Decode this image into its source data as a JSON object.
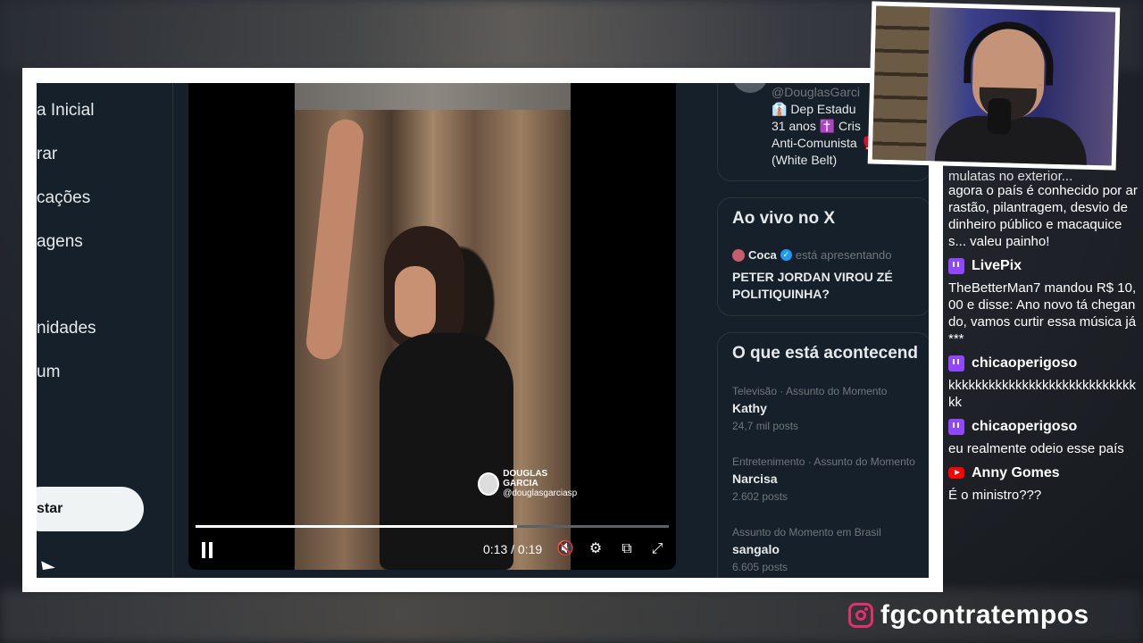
{
  "nav": {
    "items": [
      "a Inicial",
      "rar",
      "cações",
      "agens",
      "nidades",
      "um"
    ],
    "post_label": "star"
  },
  "video": {
    "watermark_name": "DOUGLAS GARCIA",
    "watermark_handle": "@douglasgarciasp",
    "time": "0:13 / 0:19",
    "progress": 0.68,
    "icons": [
      "pause-icon",
      "mute-icon",
      "settings-icon",
      "pip-icon",
      "fullscreen-icon"
    ]
  },
  "profile": {
    "handle": "@DouglasGarci",
    "bio_line1": "👔 Dep Estadu",
    "bio_line2": "31 anos ✝️ Cris",
    "bio_line3": "Anti-Comunista 🥊 Boxe",
    "bio_line4": "(White Belt)"
  },
  "live": {
    "title": "Ao vivo no X",
    "host": "Coca",
    "status": "está apresentando",
    "stream_title": "PETER JORDAN VIROU ZÉ POLITIQUINHA?"
  },
  "trends": {
    "title": "O que está acontecend",
    "items": [
      {
        "meta": "Televisão · Assunto do Momento",
        "name": "Kathy",
        "count": "24,7 mil posts"
      },
      {
        "meta": "Entretenimento · Assunto do Momento",
        "name": "Narcisa",
        "count": "2.602 posts"
      },
      {
        "meta": "Assunto do Momento em Brasil",
        "name": "sangalo",
        "count": "6.605 posts"
      }
    ]
  },
  "chat": {
    "fade_text": "mulatas no exterior...",
    "first_text": "agora o país é conhecido por arrastão, pilantragem, desvio de dinheiro público e macaquices... valeu painho!",
    "messages": [
      {
        "platform": "twitch",
        "user": "LivePix",
        "text": "TheBetterMan7 mandou R$ 10,00 e disse: Ano novo tá chegando, vamos curtir essa música já ***"
      },
      {
        "platform": "twitch",
        "user": "chicaoperigoso",
        "text": "kkkkkkkkkkkkkkkkkkkkkkkkkkkkkk"
      },
      {
        "platform": "twitch",
        "user": "chicaoperigoso",
        "text": "eu realmente odeio esse país"
      },
      {
        "platform": "youtube",
        "user": "Anny Gomes",
        "text": "É o ministro???"
      }
    ]
  },
  "social": {
    "handle": "fgcontratempos"
  }
}
